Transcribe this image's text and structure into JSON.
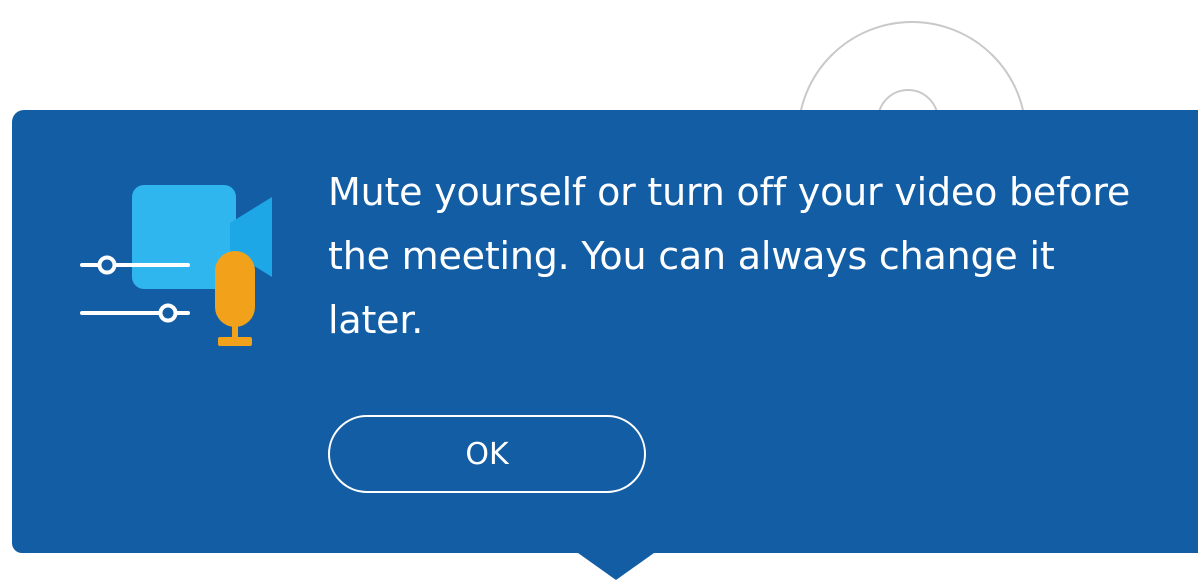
{
  "tooltip": {
    "message": "Mute yourself or turn off your video before the meeting. You can always change it later.",
    "ok_label": "OK"
  },
  "icons": {
    "illustration": "video-audio-settings-icon",
    "background": "user-avatar-icon"
  },
  "colors": {
    "tooltip_background": "#135da5",
    "camera": "#1ea7e6",
    "camera_body": "#30b6ef",
    "microphone": "#f2a21a",
    "text": "#ffffff"
  }
}
